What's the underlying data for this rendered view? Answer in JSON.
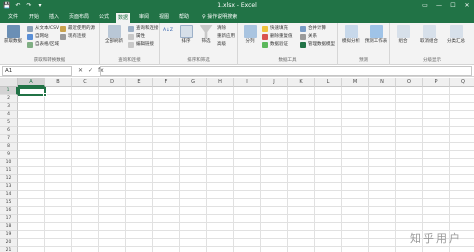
{
  "window": {
    "title": "1.xlsx - Excel",
    "qat": [
      "💾",
      "↶",
      "↷",
      "▾"
    ],
    "controls": [
      "▭",
      "—",
      "☐",
      "✕"
    ]
  },
  "tabs": [
    "文件",
    "开始",
    "插入",
    "页面布局",
    "公式",
    "数据",
    "审阅",
    "视图",
    "帮助"
  ],
  "active_tab": "数据",
  "tell_me": "♀ 操作说明搜索",
  "ribbon": {
    "get_data": {
      "big": "获取数据",
      "small": [
        "从文本/CSV",
        "自网站",
        "自表格/区域"
      ],
      "small2": [
        "最近使用的源",
        "现有连接"
      ],
      "label": "获取和转换数据"
    },
    "queries": {
      "big": "全部刷新",
      "small": [
        "查询和连接",
        "属性",
        "编辑链接"
      ],
      "label": "查询和连接"
    },
    "sort": {
      "az": "A↓Z",
      "sort": "排序",
      "filter": "筛选",
      "small": [
        "清除",
        "重新应用",
        "高级"
      ],
      "label": "排序和筛选"
    },
    "tools": {
      "big": "分列",
      "small": [
        "快速填充",
        "删除重复值",
        "数据验证"
      ],
      "small2": [
        "合并计算",
        "关系",
        "管理数据模型"
      ],
      "label": "数据工具"
    },
    "forecast": {
      "big": "模拟分析",
      "big2": "预测工作表",
      "label": "预测"
    },
    "outline": {
      "items": [
        "组合",
        "取消组合",
        "分类汇总"
      ],
      "label": "分级显示"
    }
  },
  "formula_bar": {
    "name_box": "A1",
    "fx_buttons": [
      "✕",
      "✓",
      "fx"
    ],
    "value": ""
  },
  "grid": {
    "columns": [
      "A",
      "B",
      "C",
      "D",
      "E",
      "F",
      "G",
      "H",
      "I",
      "J",
      "K",
      "L",
      "M",
      "N",
      "O",
      "P",
      "Q"
    ],
    "rows": [
      "1",
      "2",
      "3",
      "4",
      "5",
      "6",
      "7",
      "8",
      "9",
      "10",
      "11",
      "12",
      "13",
      "14",
      "15",
      "16",
      "17",
      "18",
      "19",
      "20",
      "21"
    ],
    "active_cell": "A1"
  },
  "watermark": "知乎用户",
  "colors": {
    "accent": "#217346"
  }
}
